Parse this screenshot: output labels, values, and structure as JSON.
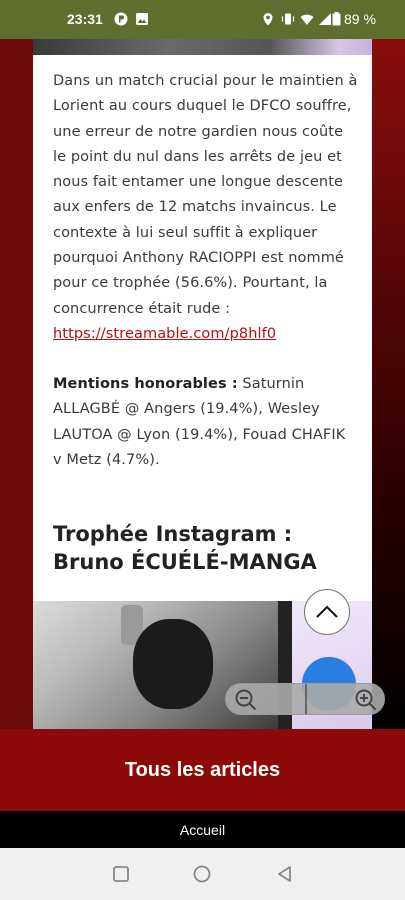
{
  "status_bar": {
    "time": "23:31",
    "battery": "89 %",
    "icons": [
      "circle-p-icon",
      "image-icon",
      "location-icon",
      "vibrate-icon",
      "wifi-icon",
      "signal-icon",
      "battery-icon"
    ]
  },
  "article": {
    "paragraph1_text": "Dans un match crucial pour le maintien à Lorient au cours duquel le DFCO souffre, une erreur de notre gardien nous coûte le point du nul dans les arrêts de jeu et nous fait entamer une longue descente aux enfers de 12 matchs invaincus. Le contexte à lui seul suffit à expliquer pourquoi Anthony RACIOPPI est nommé pour ce trophée (56.6%). Pourtant, la concurrence était rude :",
    "paragraph1_link": "https://streamable.com/p8hlf0",
    "mentions_label": "Mentions honorables :",
    "mentions_text": " Saturnin ALLAGBÉ @ Angers (19.4%), Wesley LAUTOA @ Lyon (19.4%), Fouad CHAFIK v Metz (4.7%).",
    "heading": "Trophée Instagram : Bruno ÉCUÉLÉ-MANGA"
  },
  "bottom": {
    "all_articles": "Tous les articles",
    "home": "Accueil"
  },
  "colors": {
    "status_bar": "#5e6e2f",
    "brand_red": "#8c0a0a",
    "link": "#b11212",
    "fab_blue": "#2a7de1"
  }
}
